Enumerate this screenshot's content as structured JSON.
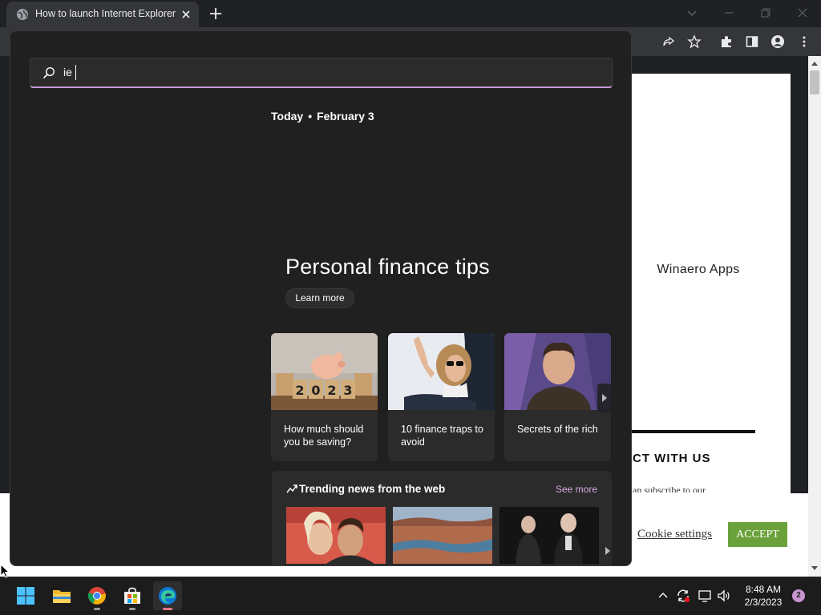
{
  "browser": {
    "tab_title": "How to launch Internet Explorer",
    "window_controls": [
      "chevron-down-icon",
      "minimize-icon",
      "restore-icon",
      "close-icon"
    ],
    "toolbar_icons": [
      "share-icon",
      "star-icon",
      "extensions-icon",
      "sidepanel-icon",
      "profile-icon",
      "menu-icon"
    ]
  },
  "webpage": {
    "app_label": "Winaero Apps",
    "section_heading": "CT WITH US",
    "subscribe_text": "an subscribe to our",
    "cookie_settings_label": "Cookie settings",
    "accept_label": "ACCEPT",
    "accent_color": "#6aa13a"
  },
  "search": {
    "query": "ie",
    "today_label": "Today",
    "date": "February 3",
    "promo_title": "Personal finance tips",
    "learn_more_label": "Learn more",
    "cards": [
      {
        "caption": "How much should you be saving?"
      },
      {
        "caption": "10 finance traps to avoid"
      },
      {
        "caption": "Secrets of the rich"
      }
    ],
    "trending_title": "Trending news from the web",
    "see_more_label": "See more",
    "accent_color": "#c896d2"
  },
  "taskbar": {
    "apps": [
      "start-icon",
      "file-explorer-icon",
      "chrome-icon",
      "store-icon",
      "edge-icon"
    ],
    "tray_icons": [
      "chevron-up-icon",
      "sync-icon",
      "display-icon",
      "volume-icon"
    ],
    "time": "8:48 AM",
    "date": "2/3/2023",
    "notification_count": "2"
  }
}
